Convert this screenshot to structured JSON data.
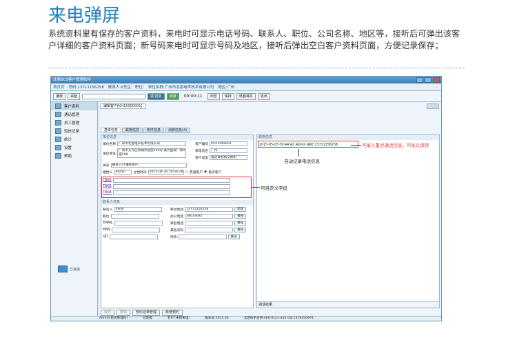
{
  "page": {
    "title": "来电弹屏",
    "description": "系统资料里有保存的客户资料，来电时可显示电话号码、联系人、职位、公司名称、地区等，接听后可弹出该客户详细的客户资料页面；新号码来电时可显示号码及地区，接听后弹出空白客户资料页面，方便记录保存；"
  },
  "app": {
    "window_title": "北恩BCS客户管理软件",
    "info": {
      "homepage": "首页页",
      "phone": "号码:13711156258",
      "contact": "联系人:X先生",
      "position": "职位:",
      "company": "单位名称:广州市北恩电声技术有限公司",
      "region": "地区:广州"
    },
    "toolbar": {
      "check_label": "播放",
      "combo2_label": "桌面",
      "dial_label": "拨/挂机",
      "transfer_label": "转接",
      "timer": "00:00:11",
      "mute_label": "闭音",
      "hold_label": "保持",
      "headset_label": "电脑耳机",
      "exit_label": "退出"
    },
    "nav": [
      {
        "label": "客户资料"
      },
      {
        "label": "通话管理"
      },
      {
        "label": "员工管理"
      },
      {
        "label": "短信记录"
      },
      {
        "label": "统计"
      },
      {
        "label": "设置"
      },
      {
        "label": "帮助"
      }
    ],
    "connection_label": "已连接",
    "doc_tab": "编辑客户[KH15000001]",
    "subtabs": [
      "基本信息",
      "联络信息",
      "附件信息",
      "消费信息(4)"
    ],
    "basic": {
      "section": "单位信息",
      "company_label": "单位名称",
      "company_value": "广州市北恩电声技术有限公司",
      "cust_no_label": "客户编号",
      "cust_no_value": "KH15000001",
      "addr_label": "单位地址",
      "addr_value": "广州市天河区黄埔大道西100号 富力盈泰广场A座508",
      "region_label": "来电地区",
      "region_value": "广州",
      "type_label": "客户类型",
      "type_value": "电话耳机和交换机",
      "relation_label": "关系",
      "relation_value": "联系人/IT维修客户",
      "creator_label": "建档人",
      "creator_value": "Admin",
      "time_label": "立档时间",
      "time_value": "2015-04-30 16:56:28",
      "radio_normal": "普通客户",
      "radio_key": "重点客户",
      "custom_fields": [
        "TBKB",
        "TBKB",
        "TBKB"
      ]
    },
    "contact": {
      "section": "联系人信息",
      "name_label": "联系人",
      "name_value": "X先生",
      "mobile_label": "移动电话",
      "mobile_value": "13711156258",
      "position_label": "职位",
      "office_label": "办公电话",
      "office_value": "38033685",
      "email_label": "EMAIL",
      "home_label": "家庭电话",
      "msn_label": "MSN",
      "other_label": "其他号码",
      "qq_label": "QQ",
      "fax_label": "传真",
      "verify_label": "验证",
      "dial_label": "拨号"
    },
    "right": {
      "section": "联络信息",
      "log_entry": "2015-05-05 09:44:42 Admin 接听 13711156258"
    },
    "result_label": "通话结果",
    "bottom_buttons": [
      "保存",
      "撤销",
      "预约记录管理",
      "新增预约"
    ],
    "status": {
      "user": "Admin[系统管理员]",
      "conn": "已连接",
      "pending": "有0个未接来电!",
      "version": "版本号:2015.03",
      "support": "北恩技术支持:400-0121-333 QQ:1319350974"
    }
  },
  "annotations": {
    "record_note": "可录入重点通话信息，可永久保存",
    "auto_record_note": "自动记录电话信息",
    "custom_note": "可自定义字段"
  },
  "colors": {
    "title": "#1f7fb8",
    "annotation_red": "#e0333a",
    "accent_blue": "#3b7fb8"
  }
}
